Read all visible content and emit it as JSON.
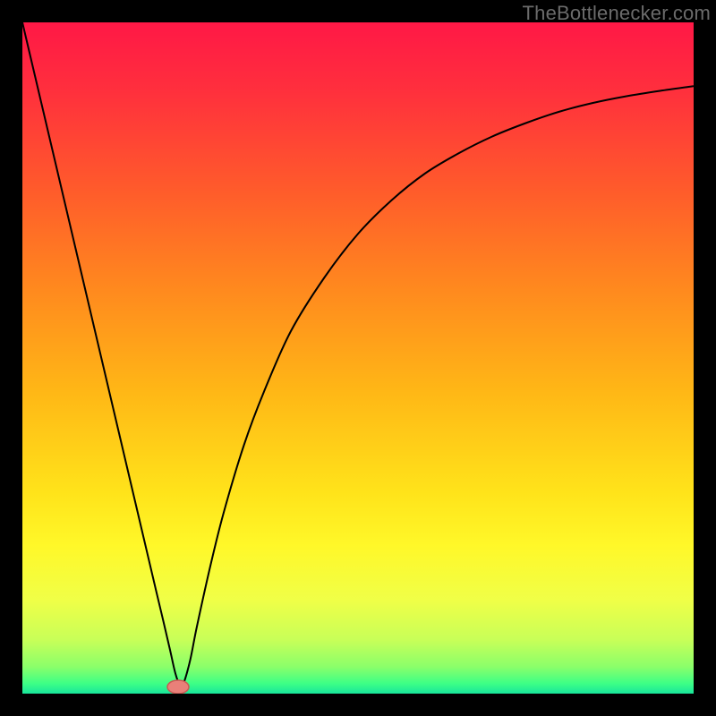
{
  "watermark": "TheBottlenecker.com",
  "colors": {
    "frame": "#000000",
    "curve": "#000000",
    "marker_fill": "#e98079",
    "marker_stroke": "#c95a54",
    "gradient_stops": [
      {
        "offset": 0.0,
        "color": "#ff1846"
      },
      {
        "offset": 0.1,
        "color": "#ff2f3d"
      },
      {
        "offset": 0.25,
        "color": "#ff5b2b"
      },
      {
        "offset": 0.4,
        "color": "#ff8a1e"
      },
      {
        "offset": 0.55,
        "color": "#ffb716"
      },
      {
        "offset": 0.7,
        "color": "#ffe31a"
      },
      {
        "offset": 0.78,
        "color": "#fff829"
      },
      {
        "offset": 0.86,
        "color": "#f0ff47"
      },
      {
        "offset": 0.92,
        "color": "#c8ff58"
      },
      {
        "offset": 0.96,
        "color": "#8bff6a"
      },
      {
        "offset": 0.985,
        "color": "#3dff86"
      },
      {
        "offset": 1.0,
        "color": "#18e59b"
      }
    ]
  },
  "chart_data": {
    "type": "line",
    "title": "",
    "xlabel": "",
    "ylabel": "",
    "xlim": [
      0,
      100
    ],
    "ylim": [
      0,
      100
    ],
    "series": [
      {
        "name": "bottleneck-curve",
        "x": [
          0,
          2,
          4,
          6,
          8,
          10,
          12,
          14,
          16,
          18,
          20,
          21,
          22,
          22.8,
          23.5,
          24,
          25,
          26,
          28,
          30,
          33,
          36,
          40,
          45,
          50,
          55,
          60,
          65,
          70,
          75,
          80,
          85,
          90,
          95,
          100
        ],
        "y": [
          100,
          91.5,
          83,
          74.5,
          66,
          57.5,
          49,
          40.5,
          32,
          23.5,
          15,
          10.8,
          6.5,
          3,
          1.2,
          1.5,
          5,
          10,
          19,
          27,
          37,
          45,
          54,
          62,
          68.5,
          73.5,
          77.5,
          80.5,
          83,
          85,
          86.7,
          88,
          89,
          89.8,
          90.5
        ]
      }
    ],
    "marker": {
      "x": 23.2,
      "y": 1.0,
      "rx": 1.6,
      "ry": 1.0
    }
  }
}
